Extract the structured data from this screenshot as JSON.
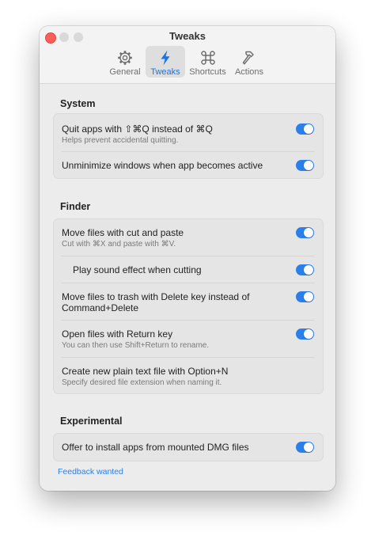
{
  "window": {
    "title": "Tweaks"
  },
  "tabs": [
    {
      "label": "General",
      "icon": "gear-icon"
    },
    {
      "label": "Tweaks",
      "icon": "lightning-bolt-icon",
      "selected": true
    },
    {
      "label": "Shortcuts",
      "icon": "command-key-icon"
    },
    {
      "label": "Actions",
      "icon": "hammer-icon"
    }
  ],
  "sections": {
    "system": {
      "title": "System",
      "rows": [
        {
          "label": "Quit apps with ⇧⌘Q instead of ⌘Q",
          "description": "Helps prevent accidental quitting.",
          "enabled": true
        },
        {
          "label": "Unminimize windows when app becomes active",
          "enabled": true
        }
      ]
    },
    "finder": {
      "title": "Finder",
      "rows": [
        {
          "label": "Move files with cut and paste",
          "description": "Cut with ⌘X and paste with ⌘V.",
          "enabled": true
        },
        {
          "label": "Play sound effect when cutting",
          "enabled": true
        },
        {
          "label_line1": "Move files to trash with Delete key instead of",
          "label_line2": "Command+Delete",
          "enabled": true
        },
        {
          "label": "Open files with Return key",
          "description": "You can then use Shift+Return to rename.",
          "enabled": true
        },
        {
          "label": "Create new plain text file with Option+N",
          "description": "Specify desired file extension when naming it."
        }
      ]
    },
    "experimental": {
      "title": "Experimental",
      "rows": [
        {
          "label": "Offer to install apps from mounted DMG files",
          "enabled": true
        }
      ]
    }
  },
  "footer": {
    "link": "Feedback wanted"
  },
  "colors": {
    "accent": "#2a7fea",
    "close": "#ff5f57"
  }
}
